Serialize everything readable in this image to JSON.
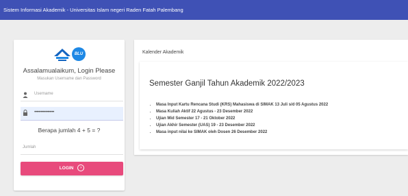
{
  "app": {
    "title": "Sistem Informasi Akademik - Universitas Islam negeri Raden Fatah Palembang"
  },
  "login": {
    "logo_text": "BLU",
    "greeting": "Assalamualaikum, Login Please",
    "subtext": "Masukan Username dan Password",
    "username_placeholder": "Username",
    "password_value": "••••••••••••••••••",
    "captcha_question": "Berapa jumlah 4 + 5 = ?",
    "jumlah_placeholder": "Jumlah",
    "login_label": "LOGIN",
    "icons": {
      "username": "user-icon",
      "password": "lock-icon",
      "login": "arrow-right-circle-icon"
    },
    "colors": {
      "login_button": "#e84a7c",
      "topbar": "#3f51b5"
    }
  },
  "calendar": {
    "header": "Kalender Akademik",
    "semester_title": "Semester Ganjil Tahun Akademik 2022/2023",
    "items": [
      "Masa Input Kartu Rencana Studi (KRS) Mahasiswa di SIMAK 13 Juli s/d 05 Agustus 2022",
      "Masa Kuliah Aktif 22 Agustus - 23 Desember 2022",
      "Ujian Mid Semester 17 - 21 Oktober 2022",
      "Ujian Akhir Semester (UAS) 19 - 23 Desember 2022",
      "Masa input nilai ke SIMAK oleh Dosen 26 Desember 2022"
    ]
  }
}
